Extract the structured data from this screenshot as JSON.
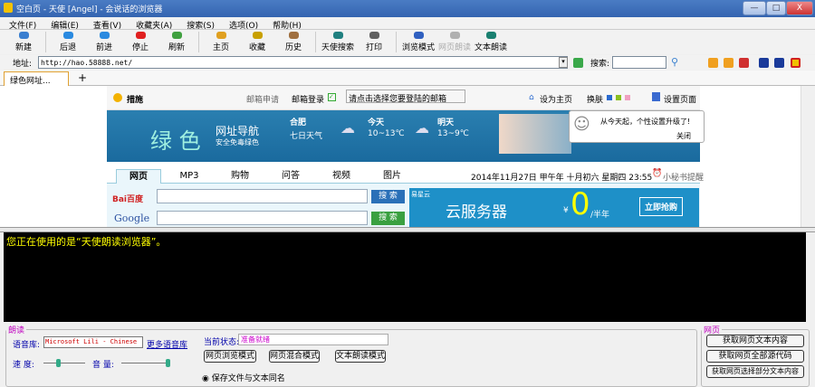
{
  "window": {
    "title": "空白页 - 天使 [Angel] - 会说话的浏览器",
    "min": "—",
    "max": "□",
    "close": "X"
  },
  "menu": [
    "文件(F)",
    "编辑(E)",
    "查看(V)",
    "收藏夹(A)",
    "搜索(S)",
    "选项(O)",
    "帮助(H)"
  ],
  "toolbar": [
    {
      "label": "新建",
      "icon": "new-icon",
      "color": "#3a7fd0"
    },
    {
      "label": "后退",
      "icon": "back-icon",
      "color": "#2a8ae0"
    },
    {
      "label": "前进",
      "icon": "forward-icon",
      "color": "#2a8ae0"
    },
    {
      "label": "停止",
      "icon": "stop-icon",
      "color": "#e02020"
    },
    {
      "label": "刷新",
      "icon": "refresh-icon",
      "color": "#40a040"
    },
    {
      "label": "主页",
      "icon": "home-icon",
      "color": "#e0a020"
    },
    {
      "label": "收藏",
      "icon": "favorites-icon",
      "color": "#c8a000"
    },
    {
      "label": "历史",
      "icon": "history-icon",
      "color": "#a07040"
    },
    {
      "label": "天使搜索",
      "icon": "search-globe-icon",
      "color": "#208080"
    },
    {
      "label": "打印",
      "icon": "print-icon",
      "color": "#606060"
    },
    {
      "label": "浏览模式",
      "icon": "browse-mode-icon",
      "color": "#3060c0"
    },
    {
      "label": "网页朗读",
      "icon": "speaker-icon",
      "color": "#b0b0b0",
      "disabled": true
    },
    {
      "label": "文本朗读",
      "icon": "text-read-icon",
      "color": "#1a8070"
    }
  ],
  "address": {
    "label": "地址:",
    "value": "http://hao.58888.net/",
    "search_label": "搜索:"
  },
  "tabs": [
    {
      "label": "绿色网址..."
    }
  ],
  "tab_new": "+",
  "tab_close": "×",
  "page": {
    "weather_city": "措施",
    "mail_apply": "邮箱申请",
    "mail_login": "邮箱登录",
    "mail_select": "请点击选择您要登陆的邮箱",
    "set_home": "设为主页",
    "skin": "换肤",
    "settings": "设置页面",
    "logo_big": "绿 色",
    "logo_title": "网址导航",
    "logo_sub": "安全免毒绿色",
    "city": "合肥",
    "seven_day": "七日天气",
    "today": "今天",
    "today_temp": "10~13℃",
    "tomorrow": "明天",
    "tomorrow_temp": "13~9℃",
    "notice": "从今天起，个性设置升级了!",
    "notice_close": "关闭",
    "search_tabs": [
      "网页",
      "MP3",
      "购物",
      "问答",
      "视频",
      "图片"
    ],
    "date": "2014年11月27日 甲午年 十月初六 星期四 23:55",
    "reminder": "小秘书提醒",
    "baidu": "Bai百度",
    "google": "Google",
    "search_btn": "搜 索",
    "ad_brand": "易星云",
    "ad_title": "云服务器",
    "ad_price": "¥",
    "ad_zero": "0",
    "ad_unit": "/半年",
    "ad_buy": "立即抢购"
  },
  "tts_text": "您正在使用的是“天使朗读浏览器”。",
  "read_panel": {
    "legend": "朗读",
    "voice_label": "语音库:",
    "voice_value": "Microsoft Lili - Chinese",
    "more_voices": "更多语音库",
    "status_label": "当前状态:",
    "status_value": "准备就绪",
    "speed_label": "速 度:",
    "volume_label": "音 量:",
    "mode_buttons": [
      "网页浏览模式",
      "网页混合模式",
      "文本朗读模式"
    ],
    "save_option": "保存文件与文本同名"
  },
  "web_panel": {
    "legend": "网页",
    "buttons": [
      "获取网页文本内容",
      "获取网页全部源代码",
      "获取网页选择部分文本内容"
    ]
  }
}
